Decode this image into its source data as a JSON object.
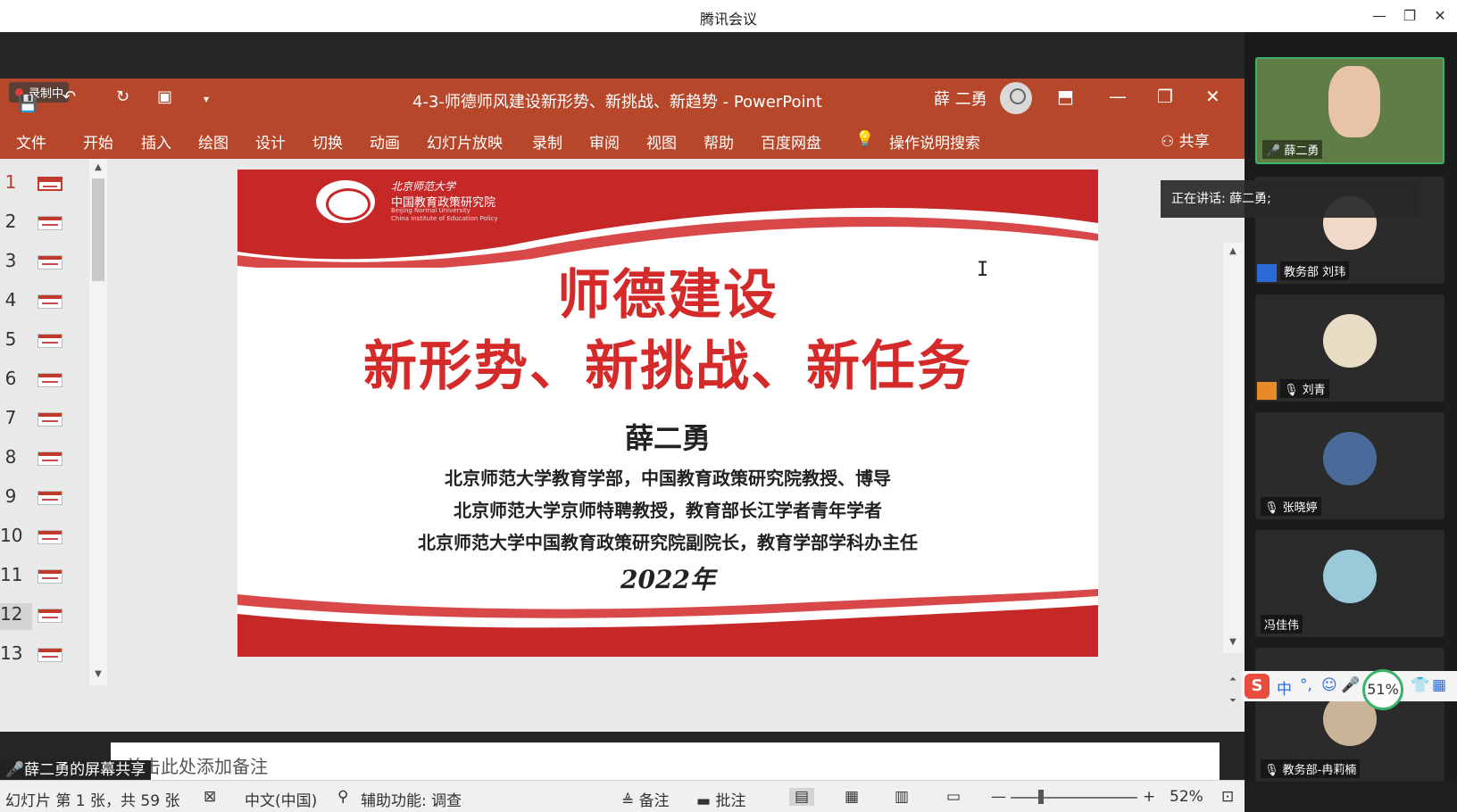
{
  "meeting": {
    "app_title": "腾讯会议",
    "minimize": "—",
    "restore": "❐",
    "close": "✕",
    "recording": "录制中",
    "share_label": "薛二勇的屏幕共享",
    "speaking": "正在讲话: 薛二勇;"
  },
  "ppt": {
    "doc_title": "4-3-师德师风建设新形势、新挑战、新趋势  -  PowerPoint",
    "user": "薛 二勇",
    "tabs": [
      "文件",
      "开始",
      "插入",
      "绘图",
      "设计",
      "切换",
      "动画",
      "幻灯片放映",
      "录制",
      "审阅",
      "视图",
      "帮助",
      "百度网盘",
      "操作说明搜索"
    ],
    "share": "共享",
    "thumbnails": [
      "1",
      "2",
      "3",
      "4",
      "5",
      "6",
      "7",
      "8",
      "9",
      "10",
      "11",
      "12",
      "13"
    ],
    "notes_hint": "单击此处添加备注",
    "status": {
      "slide_info": "幻灯片 第 1 张，共 59 张",
      "language": "中文(中国)",
      "accessibility": "辅助功能: 调查",
      "notes": "备注",
      "comments": "批注",
      "zoom": "52%",
      "minus": "—",
      "plus": "+"
    }
  },
  "slide": {
    "university_cn": "北京师范大学",
    "institute_cn": "中国教育政策研究院",
    "university_en": "Beijing Normal University",
    "institute_en": "China Institute of Education Policy",
    "title_line1": "师德建设",
    "title_line2": "新形势、新挑战、新任务",
    "author": "薛二勇",
    "affil1": "北京师范大学教育学部，中国教育政策研究院教授、博导",
    "affil2": "北京师范大学京师特聘教授，教育部长江学者青年学者",
    "affil3": "北京师范大学中国教育政策研究院副院长，教育学部学科办主任",
    "year": "2022年"
  },
  "participants": [
    {
      "name": "薛二勇",
      "avatar_color": "#6b8a4a"
    },
    {
      "name": "教务部 刘玮",
      "avatar_color": "#f0d9c9"
    },
    {
      "name": "刘青",
      "avatar_color": "#e9dcc4"
    },
    {
      "name": "张晓婷",
      "avatar_color": "#4a6b9a"
    },
    {
      "name": "冯佳伟",
      "avatar_color": "#9ac9d9"
    },
    {
      "name": "教务部-冉莉楠",
      "avatar_color": "#c9b49a"
    }
  ],
  "ime": {
    "logo": "S",
    "keys": [
      "中",
      "°,",
      "☺",
      "🎤",
      "👕",
      "▦"
    ],
    "battery": "51%"
  },
  "colors": {
    "ppt_accent": "#b7472a",
    "slide_red": "#d42a2a",
    "active_speaker": "#3bb26a"
  }
}
